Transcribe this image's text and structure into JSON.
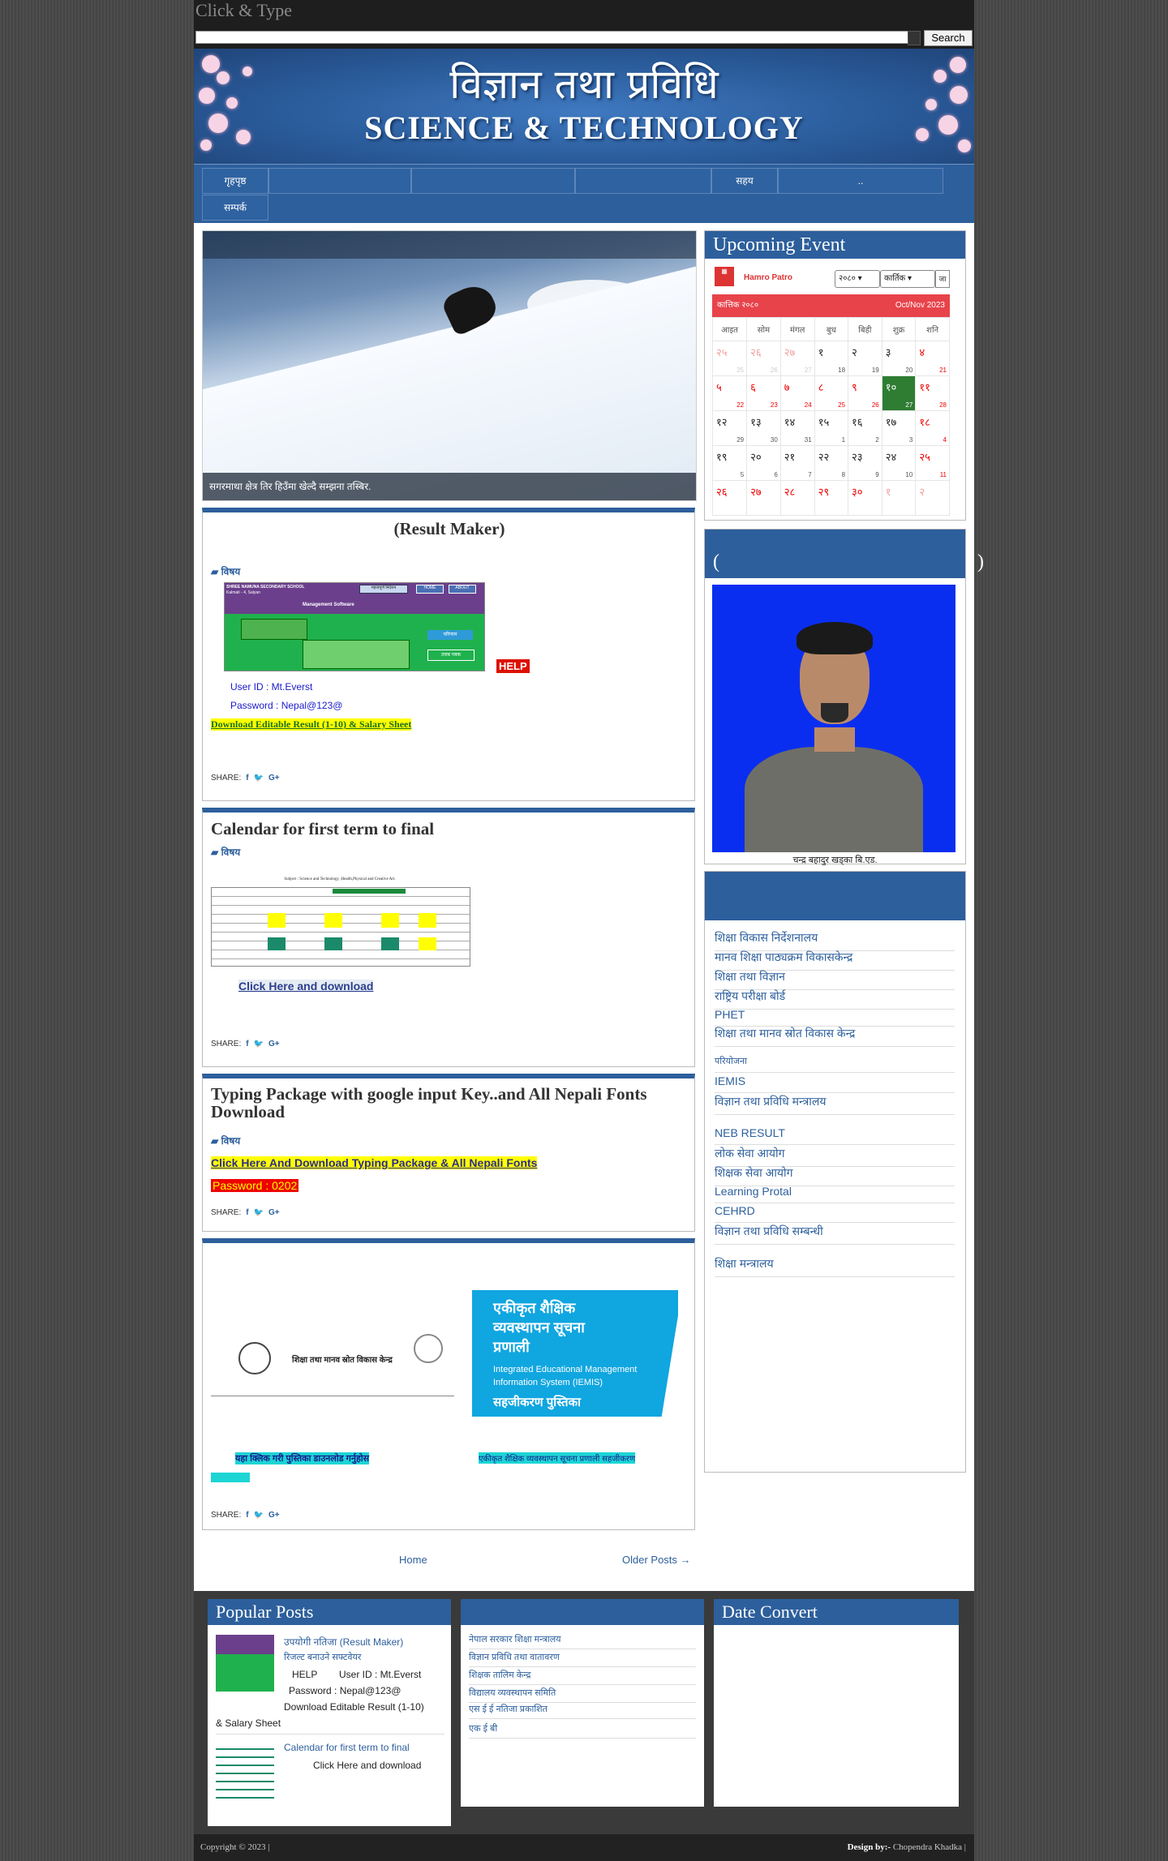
{
  "topbar": {
    "brand": "Click & Type"
  },
  "search": {
    "button": "Search",
    "value": ""
  },
  "header": {
    "title_np": "विज्ञान तथा प्रविधि",
    "title_en": "SCIENCE & TECHNOLOGY"
  },
  "nav": {
    "items": [
      "गृहपृष्ठ",
      "",
      "",
      "सहय",
      "..",
      "सम्पर्क"
    ]
  },
  "slider": {
    "caption": "सगरमाथा क्षेत्र तिर हिउँमा खेल्दै सम्झना तस्बिर."
  },
  "posts": [
    {
      "title": "(Result Maker)",
      "category": "विषय",
      "help_badge": "HELP",
      "user_id": "User ID : Mt.Everst",
      "password": "Password : Nepal@123@",
      "download": "Download Editable Result (1-10) & Salary Sheet",
      "share": "SHARE:",
      "shot": {
        "school": "SHREE NAMUNA SECONDARY SCHOOL",
        "place": "Kalmati - 4, Salyan",
        "tab1": "महत्वपूर्ण निर्देशन",
        "tab2": "HOME",
        "tab3": "ABOUT",
        "software": "Management Software",
        "btn1": "परिणाम",
        "btn2": "तलब पत्रक"
      }
    },
    {
      "title": "Calendar for first term to final",
      "category": "विषय",
      "table_title": "Subject : Science and Technology ,Health,Physical and Creative Art.",
      "download": "Click Here and download",
      "share": "SHARE:"
    },
    {
      "title": "Typing Package with google input Key..and All Nepali Fonts Download",
      "category": "विषय",
      "download": "Click Here And Download Typing Package & All Nepali Fonts",
      "password": "Password : 0202",
      "share": "SHARE:"
    },
    {
      "banner_line1": "एकीकृत शैक्षिक",
      "banner_line2": "व्यवस्थापन सूचना",
      "banner_line3": "प्रणाली",
      "banner_en1": "Integrated Educational Management",
      "banner_en2": "Information System (IEMIS)",
      "banner_footer": "सहजीकरण पुस्तिका",
      "doc_center": "शिक्षा तथा मानव स्रोत विकास केन्द्र",
      "highlight_left": "यहा क्लिक गरी पुस्तिका डाउनलोड गर्नुहोस",
      "highlight_right": "एकीकृत शैक्षिक व्यवस्थापन सूचना प्रणाली सहजीकरण",
      "share": "SHARE:"
    }
  ],
  "pagination": {
    "home": "Home",
    "older": "Older Posts →"
  },
  "sidebar": {
    "event_title": "Upcoming Event",
    "hamro_patro": "Hamro Patro",
    "select_year": "२०८०",
    "select_month": "कार्तिक",
    "go": "जा",
    "month_np": "कात्तिक २०८०",
    "month_en": "Oct/Nov 2023",
    "weekdays": [
      "आइत",
      "सोम",
      "मंगल",
      "बुध",
      "बिही",
      "शुक्र",
      "शनि"
    ],
    "cal_rows": [
      [
        [
          "२५",
          "25"
        ],
        [
          "२६",
          "26"
        ],
        [
          "२७",
          "27"
        ],
        [
          "१",
          "18"
        ],
        [
          "२",
          "19"
        ],
        [
          "३",
          "20"
        ],
        [
          "४",
          "21"
        ]
      ],
      [
        [
          "५",
          "22"
        ],
        [
          "६",
          "23"
        ],
        [
          "७",
          "24"
        ],
        [
          "८",
          "25"
        ],
        [
          "९",
          "26"
        ],
        [
          "१०",
          "27"
        ],
        [
          "११",
          "28"
        ]
      ],
      [
        [
          "१२",
          "29"
        ],
        [
          "१३",
          "30"
        ],
        [
          "१४",
          "31"
        ],
        [
          "१५",
          "1"
        ],
        [
          "१६",
          "2"
        ],
        [
          "१७",
          "3"
        ],
        [
          "१८",
          "4"
        ]
      ],
      [
        [
          "१९",
          "5"
        ],
        [
          "२०",
          "6"
        ],
        [
          "२१",
          "7"
        ],
        [
          "२२",
          "8"
        ],
        [
          "२३",
          "9"
        ],
        [
          "२४",
          "10"
        ],
        [
          "२५",
          "11"
        ]
      ],
      [
        [
          "२६",
          ""
        ],
        [
          "२७",
          ""
        ],
        [
          "२८",
          ""
        ],
        [
          "२९",
          ""
        ],
        [
          "३०",
          ""
        ],
        [
          "१",
          ""
        ],
        [
          "२",
          ""
        ]
      ]
    ],
    "profile_header": "(                                                     )",
    "profile_caption": "चन्द्र बहादुर खड्का बि.एड.",
    "links": [
      "शिक्षा विकास निर्देशनालय",
      "मानव शिक्षा पाठ्यक्रम विकासकेन्द्र",
      "शिक्षा तथा विज्ञान",
      "राष्ट्रिय परीक्षा बोर्ड",
      "PHET",
      "शिक्षा तथा मानव स्रोत विकास केन्द्र",
      "परियोजना",
      "IEMIS",
      "विज्ञान तथा प्रविधि मन्त्रालय",
      "NEB RESULT",
      "लोक सेवा आयोग",
      "शिक्षक सेवा आयोग",
      "Learning Protal",
      "CEHRD",
      "विज्ञान तथा प्रविधि सम्बन्धी",
      "शिक्षा मन्त्रालय"
    ]
  },
  "footer": {
    "popular_title": "Popular Posts",
    "pop1_title": "उपयोगी नतिजा (Result Maker)",
    "pop1_line2": "रिजल्ट बनाउने सफ्टवेयर",
    "pop1_help": "HELP",
    "pop1_user": "User ID : Mt.Everst",
    "pop1_pass": "Password : Nepal@123@",
    "pop1_dl": "Download Editable Result (1-10)",
    "pop1_dl2": "& Salary Sheet",
    "pop2_title": "Calendar for first term to final",
    "pop2_dl": "Click Here and download",
    "mid_links": [
      "नेपाल सरकार शिक्षा मन्त्रालय",
      "विज्ञान प्रविधि तथा वातावरण",
      "शिक्षक तालिम केन्द्र",
      "विद्यालय व्यवस्थापन समिति",
      "एस ई ई नतिजा प्रकाशित",
      "एक ई बी"
    ],
    "date_title": "Date Convert"
  },
  "copyright": {
    "left": "Copyright © 2023 |",
    "design_label": "Design by:-",
    "designer": "Chopendra Khadka |"
  }
}
